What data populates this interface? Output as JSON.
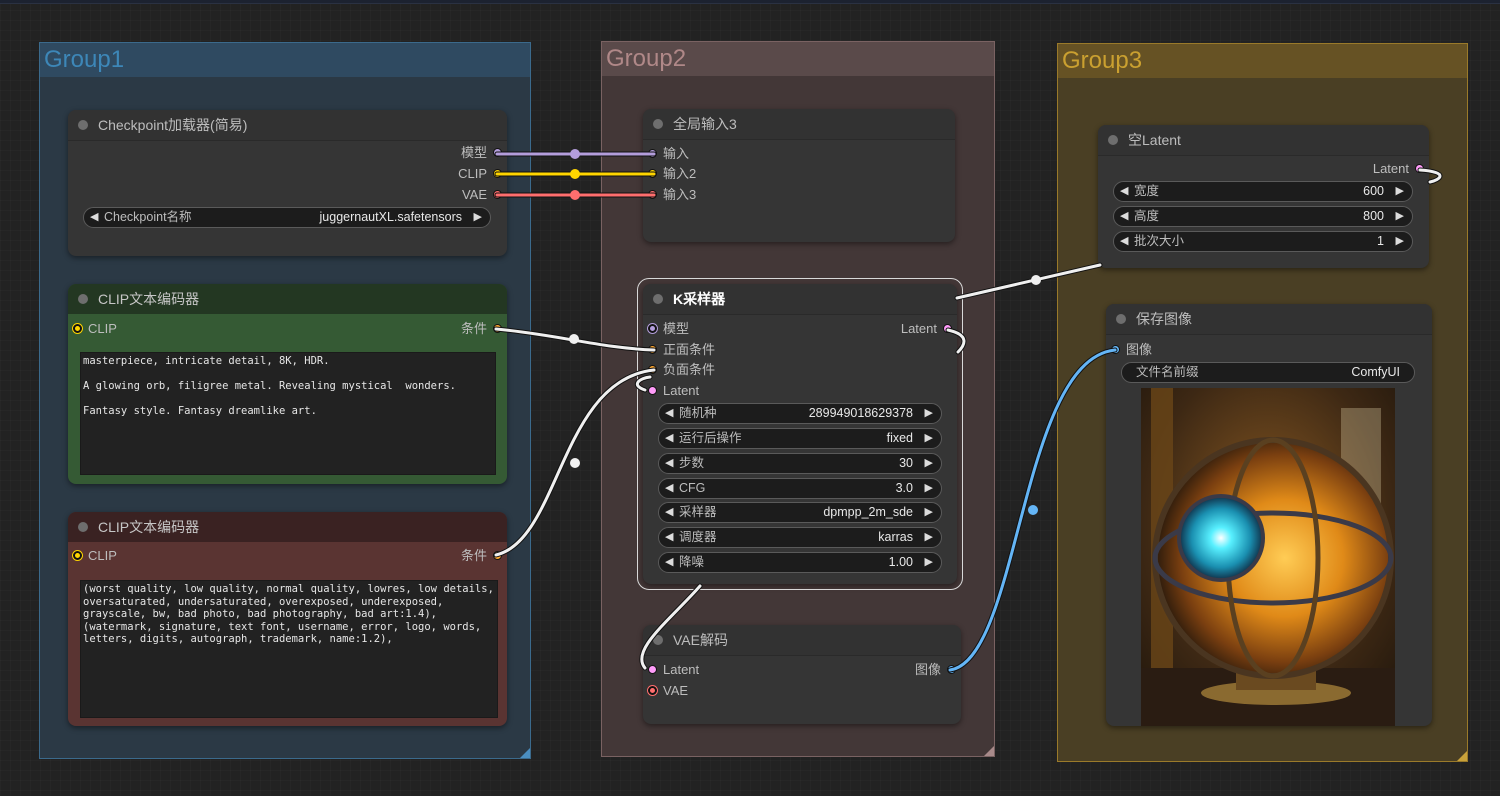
{
  "colors": {
    "model": "#b39ddb",
    "clip": "#ffd500",
    "vae": "#ff6e6e",
    "conditioning": "#ffa931",
    "latent": "#ff9cf9",
    "image": "#64b5f6",
    "wire_white": "#f0f0f0"
  },
  "groups": [
    {
      "title": "Group1"
    },
    {
      "title": "Group2"
    },
    {
      "title": "Group3"
    }
  ],
  "checkpoint_loader": {
    "title": "Checkpoint加载器(简易)",
    "outputs": [
      "模型",
      "CLIP",
      "VAE"
    ],
    "widget": {
      "label": "Checkpoint名称",
      "value": "juggernautXL.safetensors"
    }
  },
  "clip_positive": {
    "title": "CLIP文本编码器",
    "input": "CLIP",
    "output": "条件",
    "text": "masterpiece, intricate detail, 8K, HDR.\n\nA glowing orb, filigree metal. Revealing mystical  wonders.\n\nFantasy style. Fantasy dreamlike art."
  },
  "clip_negative": {
    "title": "CLIP文本编码器",
    "input": "CLIP",
    "output": "条件",
    "text": "(worst quality, low quality, normal quality, lowres, low details,\noversaturated, undersaturated, overexposed, underexposed,\ngrayscale, bw, bad photo, bad photography, bad art:1.4),\n(watermark, signature, text font, username, error, logo, words,\nletters, digits, autograph, trademark, name:1.2),"
  },
  "global_input": {
    "title": "全局输入3",
    "inputs": [
      "输入",
      "输入2",
      "输入3"
    ]
  },
  "ksampler": {
    "title": "K采样器",
    "inputs": [
      "模型",
      "正面条件",
      "负面条件",
      "Latent"
    ],
    "output": "Latent",
    "widgets": [
      {
        "label": "随机种",
        "value": "289949018629378"
      },
      {
        "label": "运行后操作",
        "value": "fixed"
      },
      {
        "label": "步数",
        "value": "30"
      },
      {
        "label": "CFG",
        "value": "3.0"
      },
      {
        "label": "采样器",
        "value": "dpmpp_2m_sde"
      },
      {
        "label": "调度器",
        "value": "karras"
      },
      {
        "label": "降噪",
        "value": "1.00"
      }
    ]
  },
  "vae_decode": {
    "title": "VAE解码",
    "inputs": [
      "Latent",
      "VAE"
    ],
    "output": "图像"
  },
  "empty_latent": {
    "title": "空Latent",
    "output": "Latent",
    "widgets": [
      {
        "label": "宽度",
        "value": "600"
      },
      {
        "label": "高度",
        "value": "800"
      },
      {
        "label": "批次大小",
        "value": "1"
      }
    ]
  },
  "save_image": {
    "title": "保存图像",
    "input": "图像",
    "widget": {
      "label": "文件名前缀",
      "value": "ComfyUI"
    },
    "preview_alt": "glowing filigree orb"
  },
  "arrows": {
    "left": "◀",
    "right": "▶"
  }
}
